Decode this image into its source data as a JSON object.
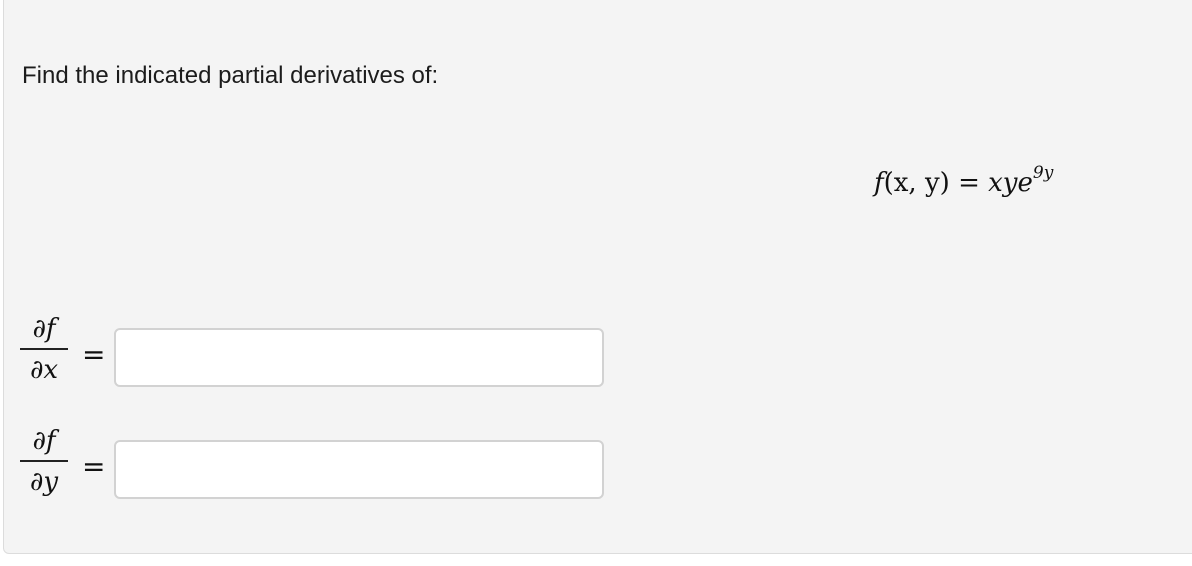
{
  "question": {
    "prompt": "Find the indicated partial derivatives of:",
    "function": {
      "lhs_name": "f",
      "lhs_args": "(x, y)",
      "equals": "=",
      "rhs_base": "xye",
      "rhs_exponent": "9y"
    }
  },
  "answers": [
    {
      "numerator": "∂f",
      "denominator": "∂x",
      "equals": "=",
      "value": "",
      "placeholder": ""
    },
    {
      "numerator": "∂f",
      "denominator": "∂y",
      "equals": "=",
      "value": "",
      "placeholder": ""
    }
  ]
}
